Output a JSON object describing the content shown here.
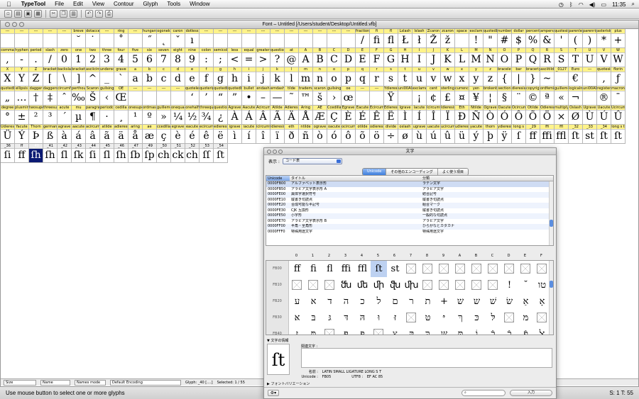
{
  "menubar": {
    "app_name": "TypeTool",
    "items": [
      "File",
      "Edit",
      "View",
      "Contour",
      "Glyph",
      "Tools",
      "Window"
    ],
    "clock": "11:35"
  },
  "font_window": {
    "title": "Font – Untitled [/Users/student/Desktop/Untitled.vfb]",
    "rows": [
      [
        [
          "---",
          ""
        ],
        [
          "---",
          ""
        ],
        [
          "---",
          ""
        ],
        [
          "---",
          ""
        ],
        [
          "---",
          ""
        ],
        [
          "breve",
          "˘"
        ],
        [
          "dotaccent",
          "˙"
        ],
        [
          "---",
          ""
        ],
        [
          "ring",
          "˚"
        ],
        [
          "---",
          ""
        ],
        [
          "hungarumlaut",
          "˝"
        ],
        [
          "ogonek",
          "˛"
        ],
        [
          "caron",
          "ˇ"
        ],
        [
          "dotless",
          "ı"
        ],
        [
          "---",
          ""
        ],
        [
          "---",
          ""
        ],
        [
          "---",
          ""
        ],
        [
          "---",
          ""
        ],
        [
          "---",
          ""
        ],
        [
          "---",
          ""
        ],
        [
          "---",
          ""
        ],
        [
          "---",
          ""
        ],
        [
          "---",
          ""
        ],
        [
          "---",
          ""
        ],
        [
          "---",
          ""
        ],
        [
          "fraction",
          "/"
        ],
        [
          "fi",
          "fi"
        ],
        [
          "fl",
          "fl"
        ],
        [
          "Lslash",
          "Ł"
        ],
        [
          "lslash",
          "ł"
        ],
        [
          "Zcaron",
          "Ž"
        ],
        [
          "zcaron",
          "ž"
        ],
        [
          "space",
          ""
        ],
        [
          "exclam",
          "!"
        ],
        [
          "quotedbl",
          "\""
        ],
        [
          "numbersign",
          "#"
        ],
        [
          "dollar",
          "$"
        ],
        [
          "percent",
          "%"
        ],
        [
          "ampersand",
          "&"
        ],
        [
          "quotesingle",
          "'"
        ],
        [
          "parenleft",
          "("
        ],
        [
          "parenright",
          ")"
        ],
        [
          "asterisk",
          "*"
        ],
        [
          "plus",
          "+"
        ]
      ],
      [
        [
          "comma",
          ","
        ],
        [
          "hyphen",
          "-"
        ],
        [
          "period",
          "."
        ],
        [
          "slash",
          "/"
        ],
        [
          "zero",
          "0"
        ],
        [
          "one",
          "1"
        ],
        [
          "two",
          "2"
        ],
        [
          "three",
          "3"
        ],
        [
          "four",
          "4"
        ],
        [
          "five",
          "5"
        ],
        [
          "six",
          "6"
        ],
        [
          "seven",
          "7"
        ],
        [
          "eight",
          "8"
        ],
        [
          "nine",
          "9"
        ],
        [
          "colon",
          ":"
        ],
        [
          "semicolon",
          ";"
        ],
        [
          "less",
          "<"
        ],
        [
          "equal",
          "="
        ],
        [
          "greater",
          ">"
        ],
        [
          "question",
          "?"
        ],
        [
          "at",
          "@"
        ],
        [
          "A",
          "A"
        ],
        [
          "B",
          "B"
        ],
        [
          "C",
          "C"
        ],
        [
          "D",
          "D"
        ],
        [
          "E",
          "E"
        ],
        [
          "F",
          "F"
        ],
        [
          "G",
          "G"
        ],
        [
          "H",
          "H"
        ],
        [
          "I",
          "I"
        ],
        [
          "J",
          "J"
        ],
        [
          "K",
          "K"
        ],
        [
          "L",
          "L"
        ],
        [
          "M",
          "M"
        ],
        [
          "N",
          "N"
        ],
        [
          "O",
          "O"
        ],
        [
          "P",
          "P"
        ],
        [
          "Q",
          "Q"
        ],
        [
          "R",
          "R"
        ],
        [
          "S",
          "S"
        ],
        [
          "T",
          "T"
        ],
        [
          "U",
          "U"
        ],
        [
          "V",
          "V"
        ],
        [
          "W",
          "W"
        ]
      ],
      [
        [
          "X",
          "X"
        ],
        [
          "Y",
          "Y"
        ],
        [
          "Z",
          "Z"
        ],
        [
          "bracketleft",
          "["
        ],
        [
          "backslash",
          "\\"
        ],
        [
          "bracketright",
          "]"
        ],
        [
          "asciicircum",
          "^"
        ],
        [
          "underscore",
          "_"
        ],
        [
          "grave",
          "`"
        ],
        [
          "a",
          "a"
        ],
        [
          "b",
          "b"
        ],
        [
          "c",
          "c"
        ],
        [
          "d",
          "d"
        ],
        [
          "e",
          "e"
        ],
        [
          "f",
          "f"
        ],
        [
          "g",
          "g"
        ],
        [
          "h",
          "h"
        ],
        [
          "i",
          "i"
        ],
        [
          "j",
          "j"
        ],
        [
          "k",
          "k"
        ],
        [
          "l",
          "l"
        ],
        [
          "m",
          "m"
        ],
        [
          "n",
          "n"
        ],
        [
          "o",
          "o"
        ],
        [
          "p",
          "p"
        ],
        [
          "q",
          "q"
        ],
        [
          "r",
          "r"
        ],
        [
          "s",
          "s"
        ],
        [
          "t",
          "t"
        ],
        [
          "u",
          "u"
        ],
        [
          "v",
          "v"
        ],
        [
          "w",
          "w"
        ],
        [
          "x",
          "x"
        ],
        [
          "y",
          "y"
        ],
        [
          "z",
          "z"
        ],
        [
          "braceleft",
          "{"
        ],
        [
          "bar",
          "|"
        ],
        [
          "braceright",
          "}"
        ],
        [
          "asciitilde",
          "~"
        ],
        [
          "_0127",
          ""
        ],
        [
          "Euro",
          "€"
        ],
        [
          "---",
          ""
        ],
        [
          "quotesinglbase",
          "‚"
        ],
        [
          "florin",
          "ƒ"
        ]
      ],
      [
        [
          "quotedblbase",
          "„"
        ],
        [
          "ellipsis",
          "…"
        ],
        [
          "dagger",
          "†"
        ],
        [
          "daggerdbl",
          "‡"
        ],
        [
          "circumflex",
          "ˆ"
        ],
        [
          "perthousand",
          "‰"
        ],
        [
          "Scaron",
          "Š"
        ],
        [
          "guilsinglleft",
          "‹"
        ],
        [
          "OE",
          "Œ"
        ],
        [
          "---",
          ""
        ],
        [
          "---",
          ""
        ],
        [
          "---",
          ""
        ],
        [
          "---",
          ""
        ],
        [
          "quoteleft",
          "‘"
        ],
        [
          "quoteright",
          "’"
        ],
        [
          "quotedblleft",
          "“"
        ],
        [
          "quotedblright",
          "”"
        ],
        [
          "bullet",
          "•"
        ],
        [
          "endash",
          "–"
        ],
        [
          "emdash",
          "—"
        ],
        [
          "tilde",
          "˜"
        ],
        [
          "trademark",
          "™"
        ],
        [
          "scaron",
          "š"
        ],
        [
          "guilsinglright",
          "›"
        ],
        [
          "oe",
          "œ"
        ],
        [
          "---",
          ""
        ],
        [
          "---",
          ""
        ],
        [
          "Ydieresis",
          "Ÿ"
        ],
        [
          "uni00A0",
          ""
        ],
        [
          "exclamdown",
          "¡"
        ],
        [
          "cent",
          "¢"
        ],
        [
          "sterling",
          "£"
        ],
        [
          "currency",
          "¤"
        ],
        [
          "yen",
          "¥"
        ],
        [
          "brokenbar",
          "¦"
        ],
        [
          "section",
          "§"
        ],
        [
          "dieresis",
          "¨"
        ],
        [
          "copyright",
          "©"
        ],
        [
          "ordfeminine",
          "ª"
        ],
        [
          "guillemotleft",
          "«"
        ],
        [
          "logicalnot",
          "¬"
        ],
        [
          "uni00AD",
          ""
        ],
        [
          "registered",
          "®"
        ],
        [
          "macron",
          "¯"
        ]
      ],
      [
        [
          "degree",
          "°"
        ],
        [
          "plusminus",
          "±"
        ],
        [
          "twosuperior",
          "²"
        ],
        [
          "threesuperior",
          "³"
        ],
        [
          "acute",
          "´"
        ],
        [
          "mu",
          "µ"
        ],
        [
          "paragraph",
          "¶"
        ],
        [
          "periodcentered",
          "·"
        ],
        [
          "cedilla",
          "¸"
        ],
        [
          "onesuperior",
          "¹"
        ],
        [
          "ordmasculine",
          "º"
        ],
        [
          "guillemotright",
          "»"
        ],
        [
          "onequarter",
          "¼"
        ],
        [
          "onehalf",
          "½"
        ],
        [
          "threequarters",
          "¾"
        ],
        [
          "questiondown",
          "¿"
        ],
        [
          "Agrave",
          "À"
        ],
        [
          "Aacute",
          "Á"
        ],
        [
          "Acircumflex",
          "Â"
        ],
        [
          "Atilde",
          "Ã"
        ],
        [
          "Adieresis",
          "Ä"
        ],
        [
          "Aring",
          "Å"
        ],
        [
          "AE",
          "Æ"
        ],
        [
          "Ccedilla",
          "Ç"
        ],
        [
          "Egrave",
          "È"
        ],
        [
          "Eacute",
          "É"
        ],
        [
          "Ecircumflex",
          "Ê"
        ],
        [
          "Edieresis",
          "Ë"
        ],
        [
          "Igrave",
          "Ì"
        ],
        [
          "Iacute",
          "Í"
        ],
        [
          "Icircumflex",
          "Î"
        ],
        [
          "Idieresis",
          "Ï"
        ],
        [
          "Eth",
          "Ð"
        ],
        [
          "Ntilde",
          "Ñ"
        ],
        [
          "Ograve",
          "Ò"
        ],
        [
          "Oacute",
          "Ó"
        ],
        [
          "Ocircumflex",
          "Ô"
        ],
        [
          "Otilde",
          "Õ"
        ],
        [
          "Odieresis",
          "Ö"
        ],
        [
          "multiply",
          "×"
        ],
        [
          "Oslash",
          "Ø"
        ],
        [
          "Ugrave",
          "Ù"
        ],
        [
          "Uacute",
          "Ú"
        ],
        [
          "Ucircumflex",
          "Û"
        ]
      ],
      [
        [
          "Udieresis",
          "Ü"
        ],
        [
          "Yacute",
          "Ý"
        ],
        [
          "Thorn",
          "Þ"
        ],
        [
          "germandbls",
          "ß"
        ],
        [
          "agrave",
          "à"
        ],
        [
          "aacute",
          "á"
        ],
        [
          "acircumflex",
          "â"
        ],
        [
          "atilde",
          "ã"
        ],
        [
          "adieresis",
          "ä"
        ],
        [
          "aring",
          "å"
        ],
        [
          "ae",
          "æ"
        ],
        [
          "ccedilla",
          "ç"
        ],
        [
          "egrave",
          "è"
        ],
        [
          "eacute",
          "é"
        ],
        [
          "ecircumflex",
          "ê"
        ],
        [
          "edieresis",
          "ë"
        ],
        [
          "igrave",
          "ì"
        ],
        [
          "iacute",
          "í"
        ],
        [
          "icircumflex",
          "î"
        ],
        [
          "idieresis",
          "ï"
        ],
        [
          "eth",
          "ð"
        ],
        [
          "ntilde",
          "ñ"
        ],
        [
          "ograve",
          "ò"
        ],
        [
          "oacute",
          "ó"
        ],
        [
          "ocircumflex",
          "ô"
        ],
        [
          "otilde",
          "õ"
        ],
        [
          "odieresis",
          "ö"
        ],
        [
          "divide",
          "÷"
        ],
        [
          "oslash",
          "ø"
        ],
        [
          "ugrave",
          "ù"
        ],
        [
          "uacute",
          "ú"
        ],
        [
          "ucircumflex",
          "û"
        ],
        [
          "udieresis",
          "ü"
        ],
        [
          "yacute",
          "ý"
        ],
        [
          "thorn",
          "þ"
        ],
        [
          "ydieresis",
          "ÿ"
        ],
        [
          "long s",
          "ſ"
        ],
        [
          "_29",
          "ff"
        ],
        [
          "ffi",
          "ffi"
        ],
        [
          "ffl",
          "ffl"
        ],
        [
          "_32",
          "ſt"
        ],
        [
          "_33",
          "st"
        ],
        [
          "_34",
          "ſt"
        ],
        [
          "long s t",
          "ſt"
        ]
      ],
      [
        [
          "_36",
          "ſi"
        ],
        [
          "ff",
          "ff"
        ],
        [
          "_40",
          "ſh"
        ],
        [
          "_41",
          "ſh"
        ],
        [
          "_42",
          "ſl"
        ],
        [
          "_43",
          "ſk"
        ],
        [
          "_44",
          "ſi"
        ],
        [
          "_45",
          "ſl"
        ],
        [
          "_46",
          "ſh"
        ],
        [
          "_47",
          "ſb"
        ],
        [
          "_49",
          "ſp"
        ],
        [
          "_50",
          "ch"
        ],
        [
          "_51",
          "ck"
        ],
        [
          "_52",
          "ch"
        ],
        [
          "_53",
          "ſſ"
        ],
        [
          "_54",
          "ſt"
        ]
      ]
    ],
    "status": {
      "size_label": "Size",
      "names_label": "Name",
      "names_mode": "Names mode",
      "encoding": "Default Encoding",
      "glyph_info": "Glyph: _40 [....]",
      "selected": "Selected: 1 / 55"
    }
  },
  "statusbar": {
    "message": "Use mouse button to select one or more glyphs",
    "right": "S: 1 T: 55"
  },
  "char_palette": {
    "title": "文字",
    "show_label": "表示 :",
    "show_value": "コード表",
    "tabs": [
      "Unicode",
      "その他のエンコーディング",
      "よく使う項目"
    ],
    "list_headers": [
      "Unicode",
      "タイトル",
      "分類"
    ],
    "list_rows": [
      [
        "0000FB00",
        "アルファベット表示形",
        "ラテン文字"
      ],
      [
        "0000FB50",
        "アラビア文字表示形 A",
        "アラビア文字"
      ],
      [
        "0000FE00",
        "異体字選択符号",
        "結合記号"
      ],
      [
        "0000FE10",
        "縦書き句読点",
        "縦書き句読点"
      ],
      [
        "0000FE20",
        "合成可能な半記号",
        "組合マーク"
      ],
      [
        "0000FE30",
        "CJK 互換形",
        "縦書き句読点"
      ],
      [
        "0000FE50",
        "小字形",
        "一般的な句読点"
      ],
      [
        "0000FE70",
        "アラビア文字表示形 B",
        "アラビア文字"
      ],
      [
        "0000FF00",
        "半角・全角形",
        "ひらがなとカタカナ"
      ],
      [
        "0000FFF0",
        "特殊用途文字",
        "特殊用途文字"
      ]
    ],
    "grid_cols": [
      "0",
      "1",
      "2",
      "3",
      "4",
      "5",
      "6",
      "7",
      "8",
      "9",
      "A",
      "B",
      "C",
      "D",
      "E",
      "F"
    ],
    "grid_rows": [
      {
        "label": "FB00",
        "cells": [
          "ff",
          "fi",
          "fl",
          "ffi",
          "ffl",
          "ſt",
          "st",
          "□",
          "□",
          "□",
          "□",
          "□",
          "□",
          "□",
          "□",
          "□"
        ]
      },
      {
        "label": "FB10",
        "cells": [
          "□",
          "□",
          "□",
          "ﬓ",
          "ﬔ",
          "ﬕ",
          "ﬖ",
          "ﬗ",
          "□",
          "□",
          "□",
          "□",
          "□",
          "!",
          "˘",
          "טו"
        ]
      },
      {
        "label": "FB20",
        "cells": [
          "ע",
          "א",
          "ד",
          "ה",
          "כ",
          "ל",
          "ם",
          "ר",
          "ת",
          "+",
          "ש",
          "ש",
          "שׁ",
          "שׂ",
          "אַ",
          "אָ"
        ]
      },
      {
        "label": "FB30",
        "cells": [
          "אּ",
          "בּ",
          "גּ",
          "דּ",
          "הּ",
          "וּ",
          "זּ",
          "□",
          "טּ",
          "יּ",
          "ךּ",
          "כּ",
          "לּ",
          "□",
          "מּ",
          "□"
        ]
      },
      {
        "label": "FB40",
        "cells": [
          "נּ",
          "סּ",
          "□",
          "ףּ",
          "פּ",
          "□",
          "צּ",
          "קּ",
          "רּ",
          "שּ",
          "תּ",
          "וֹ",
          "בֿ",
          "כֿ",
          "פֿ",
          "ﭏ"
        ]
      }
    ],
    "highlight": "FB05",
    "info_header": "文字の情報",
    "preview_glyph": "ſt",
    "related_label": "関連文字 :",
    "info_name_label": "名前 :",
    "info_name": "LATIN SMALL LIGATURE LONG S T",
    "info_unicode_label": "Unicode :",
    "info_unicode": "FB05",
    "info_utf8_label": "UTF8 :",
    "info_utf8": "EF AC 85",
    "variation_label": "フォントバリエーション",
    "insert_button": "入力"
  }
}
